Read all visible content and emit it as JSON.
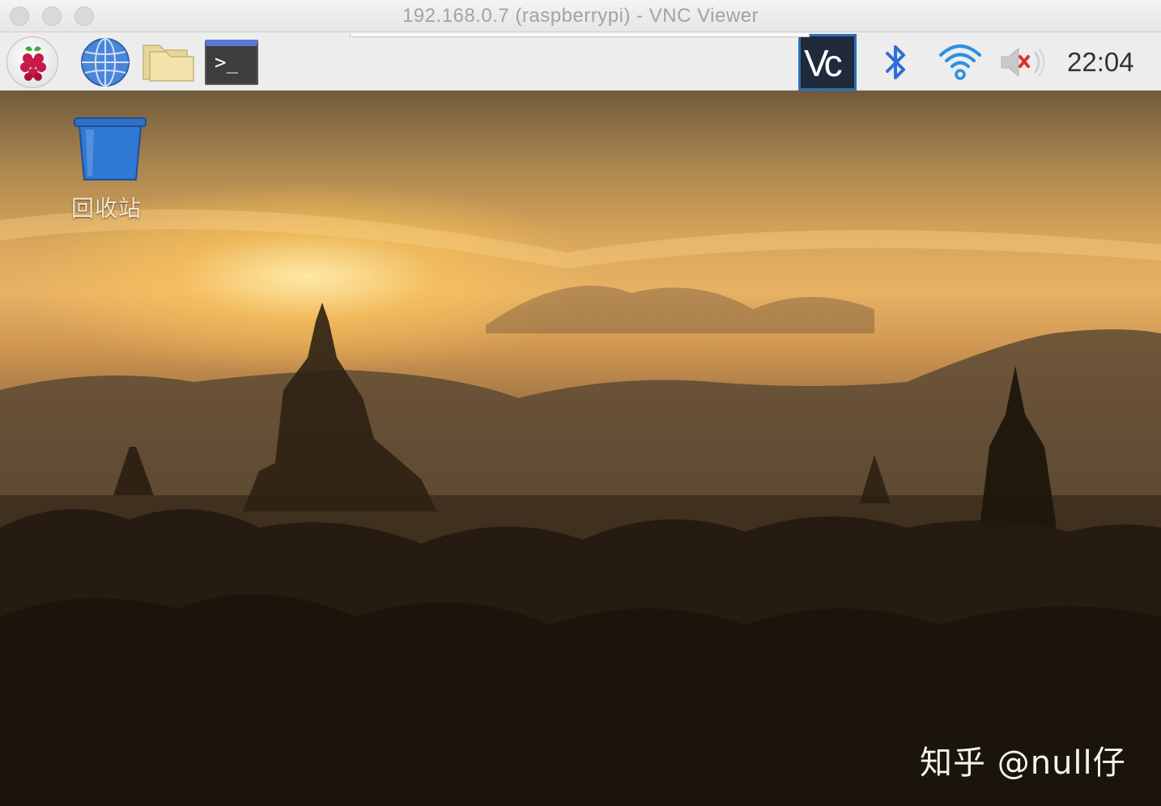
{
  "window": {
    "title": "192.168.0.7 (raspberrypi) - VNC Viewer",
    "traffic_lights": [
      "close",
      "minimize",
      "zoom"
    ]
  },
  "panel": {
    "launchers": [
      {
        "name": "raspberry-menu",
        "icon": "raspberry-icon"
      },
      {
        "name": "web-browser",
        "icon": "globe-icon"
      },
      {
        "name": "file-manager",
        "icon": "folder-icon"
      },
      {
        "name": "terminal",
        "icon": "terminal-icon",
        "glyph": ">_"
      }
    ],
    "tray": {
      "vnc_glyph": "Vc",
      "bluetooth_icon": "bluetooth-icon",
      "wifi_icon": "wifi-icon",
      "volume_icon": "volume-muted-icon",
      "clock": "22:04"
    }
  },
  "desktop": {
    "icons": [
      {
        "label": "回收站",
        "icon": "trash-icon"
      }
    ],
    "watermark": "知乎 @null仔"
  },
  "colors": {
    "accent_blue": "#2c6fb2",
    "mute_red": "#e0302e"
  }
}
